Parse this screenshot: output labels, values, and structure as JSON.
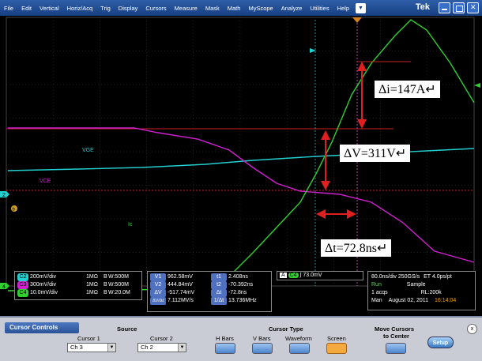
{
  "menubar": {
    "items": [
      "File",
      "Edit",
      "Vertical",
      "Horiz/Acq",
      "Trig",
      "Display",
      "Cursors",
      "Measure",
      "Mask",
      "Math",
      "MyScope",
      "Analyze",
      "Utilities",
      "Help"
    ],
    "brand": "Tek"
  },
  "colors": {
    "ch1": "#ffff00",
    "ch2": "#00e0e0",
    "ch3": "#d020d0",
    "ch4": "#30d030",
    "grid": "#2a2a2a",
    "cursor": "#cc2020"
  },
  "annotations": {
    "di": "Δi=147A↵",
    "dv": "ΔV=311V↵",
    "dt": "Δt=72.8ns↵"
  },
  "trace_labels": {
    "vge": "VGE",
    "vce": "VCE",
    "ic": "Ic"
  },
  "channels": [
    {
      "id": "C2",
      "text": "200mV/div",
      "imp": "1MΩ",
      "bw": "B",
      "bwval": "W:500M"
    },
    {
      "id": "C3",
      "text": "300mV/div",
      "imp": "1MΩ",
      "bw": "B",
      "bwval": "W:500M"
    },
    {
      "id": "C4",
      "text": "10.0mV/div",
      "imp": "1MΩ",
      "bw": "B",
      "bwval": "W:20.0M"
    }
  ],
  "readouts": {
    "v1": "962.58mV",
    "v2": "444.84mV",
    "dv": "-517.74mV",
    "dvdt": "7.112MV/s",
    "t1": "2.408ns",
    "t2": "-70.392ns",
    "dt": "-72.8ns",
    "inv": "13.736MHz",
    "lab_v1": "V1",
    "lab_v2": "V2",
    "lab_dv": "ΔV",
    "lab_dvdt": "ΔV/Δt",
    "lab_t1": "t1",
    "lab_t2": "t2",
    "lab_dt": "Δt",
    "lab_inv": "1/Δt"
  },
  "trigger": {
    "box": "A",
    "ch": "C4",
    "level": "73.0mV"
  },
  "acq": {
    "timebase": "80.0ns/div",
    "rate": "250GS/s",
    "et": "ET",
    "res": "4.0ps/pt",
    "state": "Run",
    "mode": "Sample",
    "acqs": "1 acqs",
    "rl": "RL:200k",
    "trig": "Man",
    "date": "August 02, 2011",
    "time": "16:14:04"
  },
  "panel": {
    "title": "Cursor Controls",
    "source": "Source",
    "cursor1": "Cursor 1",
    "cursor2": "Cursor 2",
    "c1_val": "Ch 3",
    "c2_val": "Ch 2",
    "cursor_type": "Cursor Type",
    "hbars": "H Bars",
    "vbars": "V Bars",
    "waveform": "Waveform",
    "screen": "Screen",
    "move": "Move Cursors",
    "move2": "to Center",
    "setup": "Setup",
    "close": "x"
  },
  "markers": {
    "ch2_marker": "2",
    "ch4_marker": "4",
    "trig_top": "R",
    "ch_b": "b"
  }
}
